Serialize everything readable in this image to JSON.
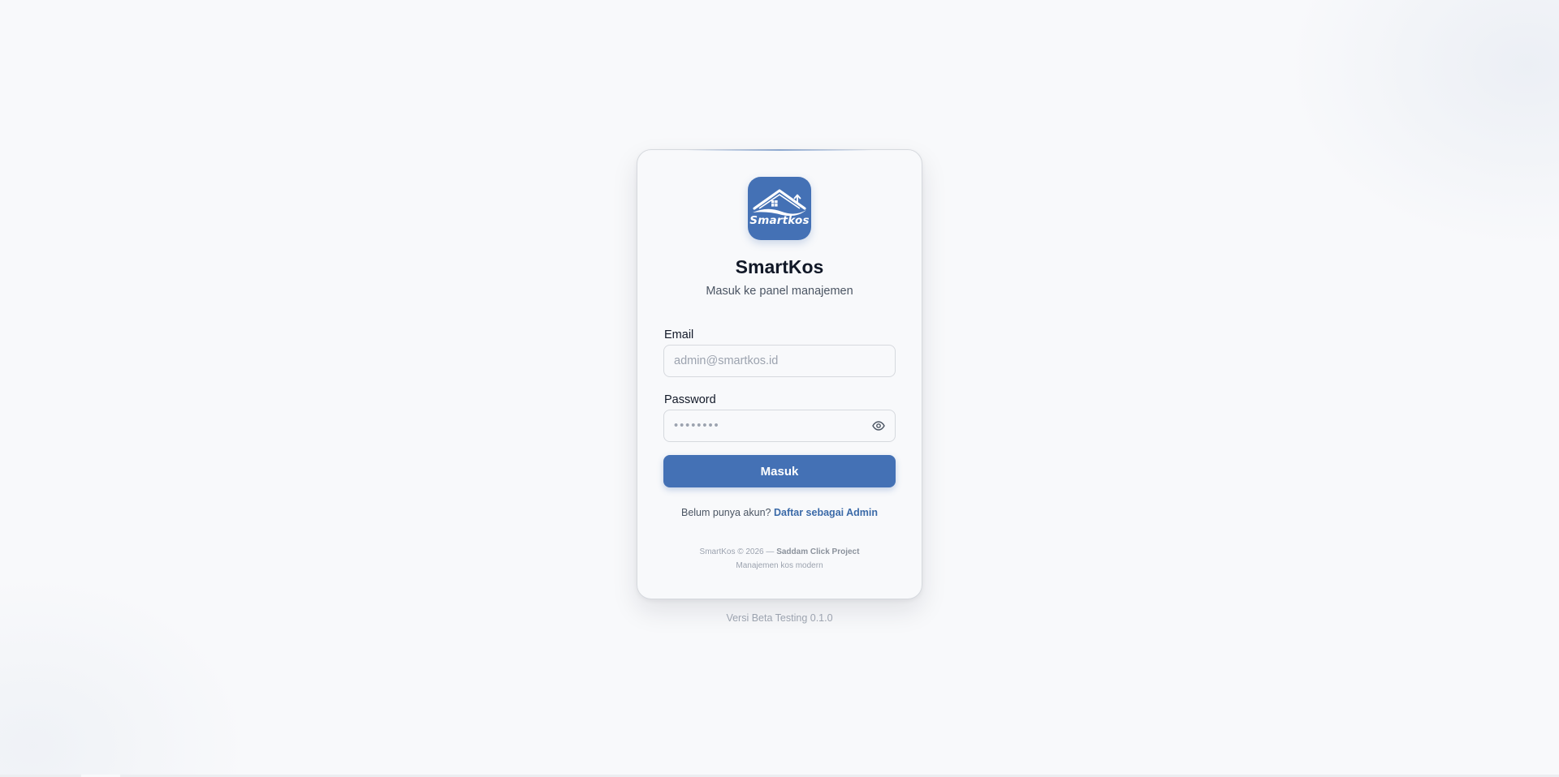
{
  "brand": {
    "logo_text": "Smartkos",
    "title": "SmartKos",
    "subtitle": "Masuk ke panel manajemen",
    "accent_color": "#4471b5"
  },
  "form": {
    "email_label": "Email",
    "email_placeholder": "admin@smartkos.id",
    "email_value": "",
    "password_label": "Password",
    "password_placeholder": "••••••••",
    "password_value": "",
    "toggle_icon": "eye-icon",
    "submit_label": "Masuk"
  },
  "register": {
    "prompt": "Belum punya akun?",
    "link_label": "Daftar sebagai Admin"
  },
  "footer": {
    "copyright": "SmartKos © 2026 —",
    "project": "Saddam Click Project",
    "tagline": "Manajemen kos modern"
  },
  "version": "Versi Beta Testing 0.1.0"
}
